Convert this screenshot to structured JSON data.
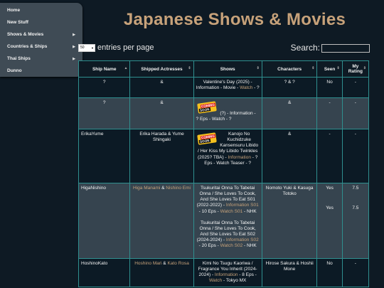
{
  "nav": {
    "items": [
      {
        "label": "Home",
        "arrow": ""
      },
      {
        "label": "New Stuff",
        "arrow": ""
      },
      {
        "label": "Shows & Movies",
        "arrow": "▶"
      },
      {
        "label": "Countries & Ships",
        "arrow": "▶"
      },
      {
        "label": "Thai Ships",
        "arrow": "▶"
      },
      {
        "label": "Dunno",
        "arrow": ""
      }
    ]
  },
  "title": "Japanese Shows & Movies",
  "length": {
    "value": "50",
    "suffix": "entries per page"
  },
  "search": {
    "label": "Search:"
  },
  "table": {
    "headers": [
      "Ship Name",
      "Shipped Actresses",
      "Shows",
      "Characters",
      "Seen",
      "My Rating"
    ],
    "badge": {
      "line1": "COMING",
      "line2": "SOON"
    },
    "rows": [
      {
        "ship": "?",
        "actresses": "&",
        "show_text": "Valentine's Day (2025) - Information - Movie - ",
        "show_link": "Watch",
        "show_tail": " - ?",
        "characters": "? & ?",
        "seen": "No",
        "rating": "-"
      },
      {
        "ship": "?",
        "actresses": "&",
        "show_text": "(?) - Information - ? Eps - Watch - ?",
        "characters": "&",
        "seen": "-",
        "rating": "-"
      },
      {
        "ship": "ErikaYume",
        "actresses": "Erika Harada & Yume Shingaki",
        "show_text": "Kanojo No Kuchidzuke Kansensuru Libido / Her Kiss My Libido Twinkles (2025? TBA) - ",
        "show_link": "Information",
        "show_tail": " - ? Eps - Watch Teaser - ?",
        "characters": "&",
        "seen": "-",
        "rating": "-"
      },
      {
        "ship": "HigaNishino",
        "actress_a": "Higa Manami",
        "actress_amp": " & ",
        "actress_b": "Nishino Emi",
        "show1_text": "Tsukuritai Onna To Tabetai Onna / She Loves To Cook, And She Loves To Eat S01 (2022-2022) - ",
        "show1_link": "Information S01",
        "show1_mid": " - 10 Eps - ",
        "show1_link2": "Watch S01",
        "show1_tail": " - NHK",
        "show2_text": "Tsukuritai Onna To Tabetai Onna / She Loves To Cook, And She Loves To Eat S02 (2024-2024) - ",
        "show2_link": "Information S02",
        "show2_mid": " - 20 Eps - ",
        "show2_link2": "Watch S02",
        "show2_tail": " - NHK",
        "characters": "Nomoto Yuki & Kasuga Totoko",
        "seen1": "Yes",
        "seen2": "Yes",
        "rating1": "7.5",
        "rating2": "7.5"
      },
      {
        "ship": "HoshinoKato",
        "actress_a": "Hoshino Mari",
        "actress_amp": " & ",
        "actress_b": "Kato Rosa",
        "show_text": "Kimi No Tsugu Kaoriwa / Fragrance You Inherit (2024-2024) - ",
        "show_link": "Information",
        "show_mid": " - 8 Eps - ",
        "show_link2": "Watch",
        "show_tail": " - Tokyo MX",
        "characters": "Hirose Sakura & Hoshii Mone",
        "seen": "No",
        "rating": "-"
      }
    ]
  }
}
